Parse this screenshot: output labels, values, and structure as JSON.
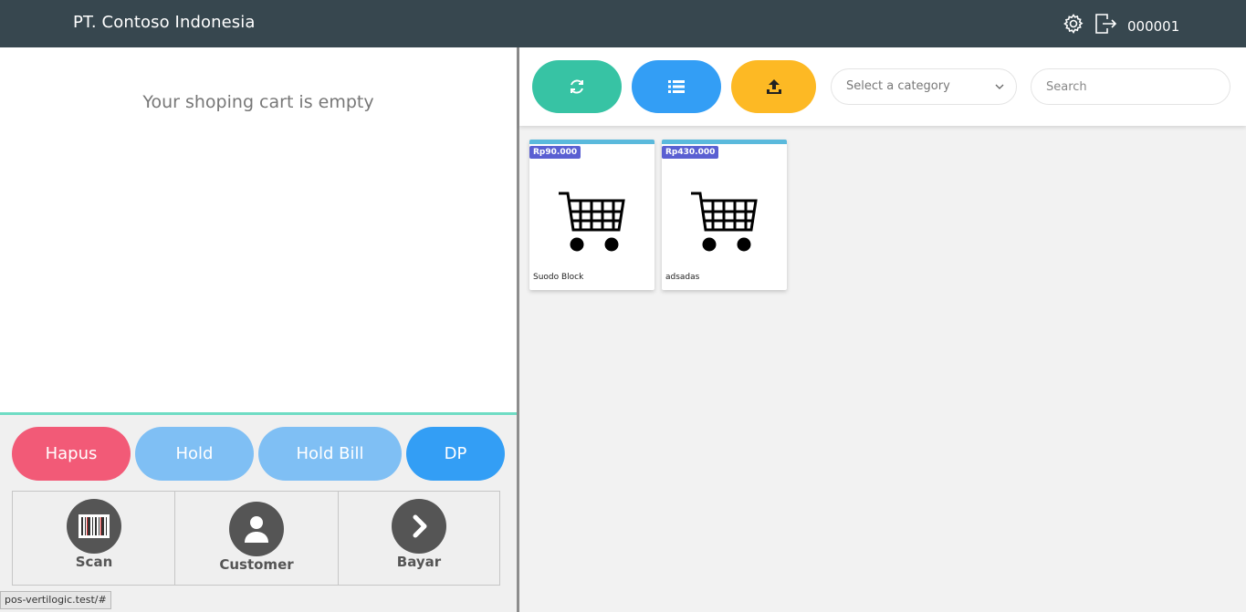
{
  "header": {
    "brand": "PT. Contoso Indonesia",
    "user_id": "000001",
    "icons": [
      "gear-icon",
      "logout-icon"
    ]
  },
  "cart": {
    "empty_message": "Your shoping cart is empty"
  },
  "cart_actions": {
    "hapus": "Hapus",
    "hold": "Hold",
    "hold_bill": "Hold Bill",
    "dp": "DP"
  },
  "bottom_actions": {
    "scan": "Scan",
    "customer": "Customer",
    "bayar": "Bayar"
  },
  "toolbar": {
    "category_placeholder": "Select a category",
    "search_placeholder": "Search"
  },
  "products": [
    {
      "price": "Rp90.000",
      "name": "Suodo Block"
    },
    {
      "price": "Rp430.000",
      "name": "adsadas"
    }
  ],
  "status_url": "pos-vertilogic.test/#",
  "colors": {
    "header": "#37474f",
    "hapus": "#f25a77",
    "hold": "#7fbff4",
    "dp": "#339ef5",
    "refresh": "#37c3a4",
    "upload": "#fdb924",
    "price_badge": "#5a5fd2"
  }
}
